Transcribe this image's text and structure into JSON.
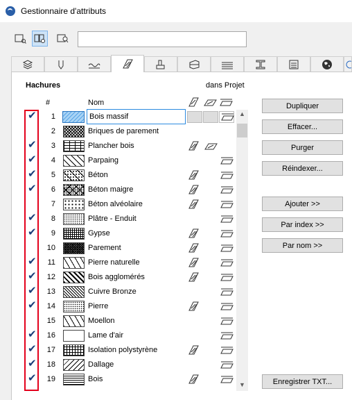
{
  "window": {
    "title": "Gestionnaire d'attributs"
  },
  "toolbar": {
    "view_icons": [
      "list-view-icon",
      "split-view-icon",
      "detail-view-icon"
    ],
    "active_index": 1,
    "search_value": ""
  },
  "tabs": [
    "layers-icon",
    "pen-icon",
    "line-icon",
    "fill-icon",
    "building-material-icon",
    "composite-icon",
    "surface-icon",
    "profile-icon",
    "zone-icon",
    "markup-icon",
    "globe-icon"
  ],
  "active_tab": 3,
  "section": {
    "title": "Hachures",
    "project_label": "dans Projet"
  },
  "columns": {
    "number": "#",
    "name": "Nom"
  },
  "rows": [
    {
      "num": "1",
      "name": "Bois massif",
      "checked": true,
      "pattern": "hatch-diag"
    },
    {
      "num": "2",
      "name": "Briques de parement",
      "checked": false,
      "pattern": "crosshatch"
    },
    {
      "num": "3",
      "name": "Plancher bois",
      "checked": true,
      "pattern": "brick"
    },
    {
      "num": "4",
      "name": "Parpaing",
      "checked": true,
      "pattern": "diag"
    },
    {
      "num": "5",
      "name": "Béton",
      "checked": true,
      "pattern": "dots-diag"
    },
    {
      "num": "6",
      "name": "Béton maigre",
      "checked": true,
      "pattern": "dots-cross"
    },
    {
      "num": "7",
      "name": "Béton alvéolaire",
      "checked": false,
      "pattern": "dots"
    },
    {
      "num": "8",
      "name": "Plâtre - Enduit",
      "checked": true,
      "pattern": "fine-dots"
    },
    {
      "num": "9",
      "name": "Gypse",
      "checked": true,
      "pattern": "grid"
    },
    {
      "num": "10",
      "name": "Parement",
      "checked": false,
      "pattern": "dense-cross"
    },
    {
      "num": "11",
      "name": "Pierre naturelle",
      "checked": true,
      "pattern": "stone"
    },
    {
      "num": "12",
      "name": "Bois agglomérés",
      "checked": true,
      "pattern": "wood"
    },
    {
      "num": "13",
      "name": "Cuivre Bronze",
      "checked": true,
      "pattern": "diag-thick"
    },
    {
      "num": "14",
      "name": "Pierre",
      "checked": true,
      "pattern": "fine-dots"
    },
    {
      "num": "15",
      "name": "Moellon",
      "checked": false,
      "pattern": "stone"
    },
    {
      "num": "16",
      "name": "Lame d'air",
      "checked": true,
      "pattern": "blank"
    },
    {
      "num": "17",
      "name": "Isolation polystyrène",
      "checked": true,
      "pattern": "grid-fine"
    },
    {
      "num": "18",
      "name": "Dallage",
      "checked": true,
      "pattern": "diag-wide"
    },
    {
      "num": "19",
      "name": "Bois",
      "checked": true,
      "pattern": "wave"
    }
  ],
  "buttons": {
    "dupliquer": "Dupliquer",
    "effacer": "Effacer...",
    "purger": "Purger",
    "reindexer": "Réindexer...",
    "ajouter": "Ajouter >>",
    "par_index": "Par index >>",
    "par_nom": "Par nom >>",
    "enregistrer": "Enregistrer TXT..."
  },
  "colors": {
    "accent": "#2b8ae0",
    "highlight": "#e3001b",
    "check": "#1a3c78"
  }
}
